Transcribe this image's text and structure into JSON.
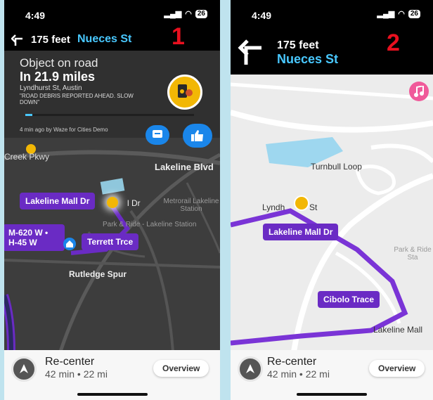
{
  "colors": {
    "route": "#7a34d6",
    "nav_street": "#49c8ff",
    "panel": "#303030",
    "annotation": "#e8101f",
    "badge_orange": "#f2b705",
    "action_blue": "#1a86ea",
    "water": "#9ed7ef",
    "music_pink": "#f05a9a"
  },
  "screens": [
    {
      "annotation": "1",
      "status": {
        "time": "4:49",
        "battery": "26"
      },
      "nav": {
        "distance": "175 feet",
        "street": "Nueces St",
        "turn_icon": "turn-left-icon"
      },
      "alert": {
        "title": "Object on road",
        "distance": "In 21.9 miles",
        "location": "Lyndhurst St, Austin",
        "message": "\"ROAD DEBRIS REPORTED AHEAD. SLOW DOWN\"",
        "source": "4 min ago by Waze for Cities Demo",
        "progress": 0.04
      },
      "map": {
        "labels": [
          "Creek Pkwy",
          "Lakeline Blvd",
          "Metrorail Lakeline Station",
          "Park & Ride - Lakeline Station",
          "Rutledge Spur",
          "l Dr"
        ],
        "pills": [
          "Lakeline Mall Dr",
          "M-620 W • H-45 W",
          "Terrett Trce"
        ]
      },
      "bottom": {
        "title": "Re-center",
        "subtitle": "42 min • 22 mi",
        "overview": "Overview"
      }
    },
    {
      "annotation": "2",
      "status": {
        "time": "4:49",
        "battery": "26"
      },
      "nav": {
        "distance": "175 feet",
        "street": "Nueces St",
        "turn_icon": "turn-left-icon"
      },
      "map": {
        "labels": [
          "Turnbull Loop",
          "Lyndh",
          "St",
          "Park & Ride Sta",
          "Lakeline Mall"
        ],
        "pills": [
          "Lakeline Mall Dr",
          "Cibolo Trace"
        ]
      },
      "bottom": {
        "title": "Re-center",
        "subtitle": "42 min • 22 mi",
        "overview": "Overview"
      }
    }
  ]
}
